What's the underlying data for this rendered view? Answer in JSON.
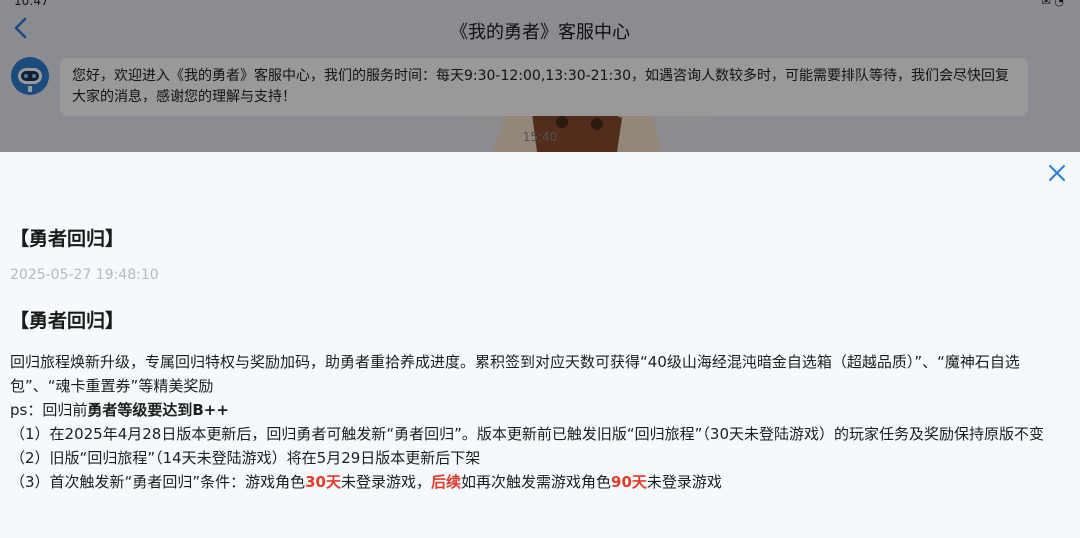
{
  "status_bar": {
    "clock": "10:47",
    "indicators": "✉ ◔"
  },
  "nav": {
    "back_icon": "chevron-left-icon",
    "title": "《我的勇者》客服中心"
  },
  "chat": {
    "avatar_icon": "robot-icon",
    "welcome_message": "您好，欢迎进入《我的勇者》客服中心，我们的服务时间：每天9:30-12:00,13:30-21:30，如遇咨询人数较多时，可能需要排队等待，我们会尽快回复大家的消息，感谢您的理解与支持！",
    "message_time": "15:40"
  },
  "notice": {
    "close_icon": "close-icon",
    "title": "【勇者回归】",
    "date": "2025-05-27 19:48:10",
    "section_heading": "【勇者回归】",
    "intro": "回归旅程焕新升级，专属回归特权与奖励加码，助勇者重拾养成进度。累积签到对应天数可获得“40级山海经混沌暗金自选箱（超越品质）”、“魔神石自选包”、“魂卡重置券”等精美奖励",
    "ps_prefix": "ps：回归前",
    "ps_bold": "勇者等级要达到B++",
    "item1": "（1）在2025年4月28日版本更新后，回归勇者可触发新“勇者回归”。版本更新前已触发旧版“回归旅程”（30天未登陆游戏）的玩家任务及奖励保持原版不变",
    "item2": "（2）旧版“回归旅程”（14天未登陆游戏）将在5月29日版本更新后下架",
    "item3_part1": "（3）首次触发新“勇者回归”条件：游戏角色",
    "item3_days1": "30天",
    "item3_part2": "未登录游戏，",
    "item3_followup": "后续",
    "item3_part3": "如再次触发需游戏角色",
    "item3_days2": "90天",
    "item3_part4": "未登录游戏"
  },
  "colors": {
    "accent": "#2f7fd1",
    "highlight_red": "#e23b2a",
    "sheet_bg": "#f4f9fb"
  }
}
